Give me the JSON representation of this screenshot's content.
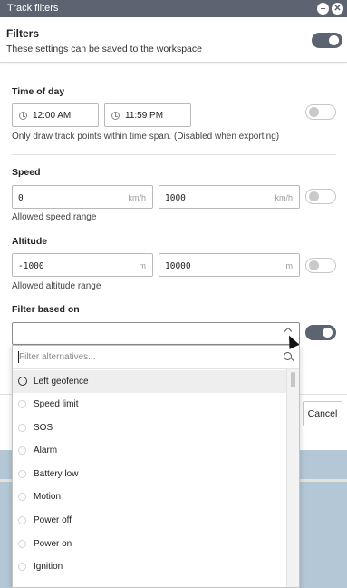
{
  "window": {
    "title": "Track filters"
  },
  "header": {
    "title": "Filters",
    "subtitle": "These settings can be saved to the workspace",
    "toggle_on": true
  },
  "time_of_day": {
    "label": "Time of day",
    "start": "12:00 AM",
    "end": "11:59 PM",
    "help": "Only draw track points within time span. (Disabled when exporting)",
    "toggle_on": false
  },
  "speed": {
    "label": "Speed",
    "min": "0",
    "max": "1000",
    "unit": "km/h",
    "help": "Allowed speed range",
    "toggle_on": false
  },
  "altitude": {
    "label": "Altitude",
    "min": "-1000",
    "max": "10000",
    "unit": "m",
    "help": "Allowed altitude range",
    "toggle_on": false
  },
  "filter_based_on": {
    "label": "Filter based on",
    "value": "",
    "toggle_on": true,
    "search_placeholder": "Filter alternatives...",
    "options": [
      "Left geofence",
      "Speed limit",
      "SOS",
      "Alarm",
      "Battery low",
      "Motion",
      "Power off",
      "Power on",
      "Ignition"
    ],
    "highlighted_index": 0
  },
  "footer": {
    "cancel_label": "Cancel"
  }
}
